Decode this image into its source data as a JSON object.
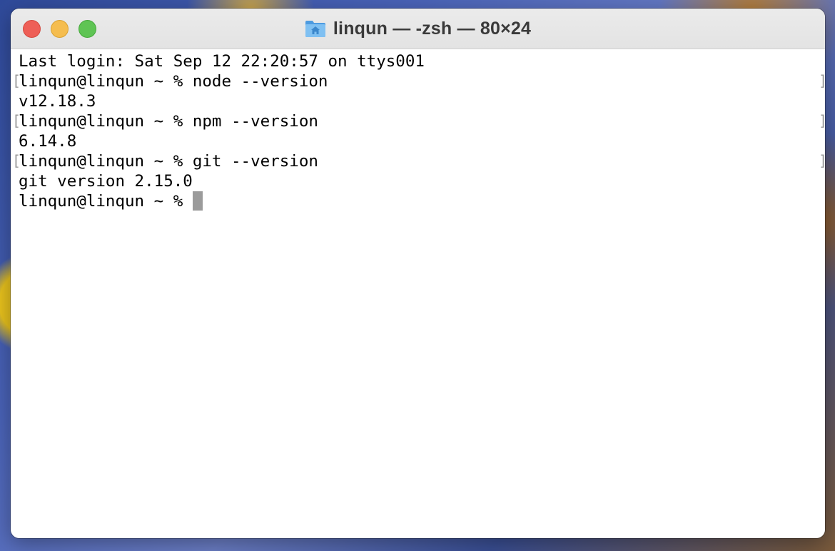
{
  "window": {
    "title": "linqun — -zsh — 80×24",
    "icon": "folder-home-icon",
    "traffic_lights": [
      "close-button",
      "minimize-button",
      "zoom-button"
    ]
  },
  "terminal": {
    "lines": [
      {
        "text": "Last login: Sat Sep 12 22:20:57 on ttys001",
        "marked": false
      },
      {
        "text": "linqun@linqun ~ % node --version",
        "marked": true
      },
      {
        "text": "v12.18.3",
        "marked": false
      },
      {
        "text": "linqun@linqun ~ % npm --version",
        "marked": true
      },
      {
        "text": "6.14.8",
        "marked": false
      },
      {
        "text": "linqun@linqun ~ % git --version",
        "marked": true
      },
      {
        "text": "git version 2.15.0",
        "marked": false
      }
    ],
    "prompt": "linqun@linqun ~ % ",
    "cursor_color": "#9b9b9b"
  },
  "colors": {
    "close": "#ee5f57",
    "minimize": "#f5bd4f",
    "zoom": "#5fc454",
    "folder": "#5aa7e6"
  }
}
